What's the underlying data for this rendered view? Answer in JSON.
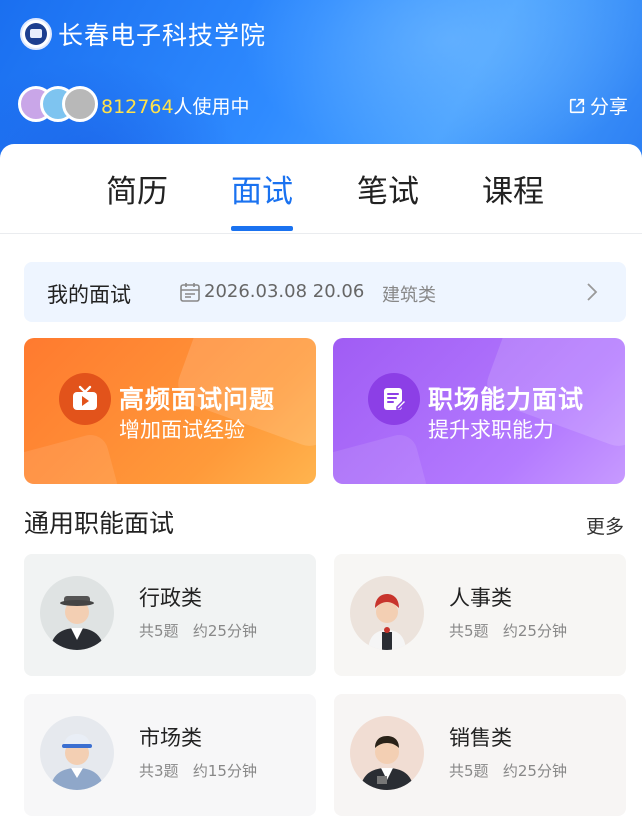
{
  "header": {
    "school_name": "长春电子科技学院",
    "user_count": "812764",
    "user_suffix": "人使用中",
    "share_label": "分享"
  },
  "tabs": [
    {
      "label": "简历",
      "active": false
    },
    {
      "label": "面试",
      "active": true
    },
    {
      "label": "笔试",
      "active": false
    },
    {
      "label": "课程",
      "active": false
    }
  ],
  "my_interview": {
    "label": "我的面试",
    "date": "2026.03.08 20.06",
    "category": "建筑类"
  },
  "feature_cards": [
    {
      "title": "高频面试问题",
      "subtitle": "增加面试经验",
      "icon": "tv-play-icon",
      "color": "#ff8a35"
    },
    {
      "title": "职场能力面试",
      "subtitle": "提升求职能力",
      "icon": "edit-document-icon",
      "color": "#a86af7"
    }
  ],
  "section": {
    "title": "通用职能面试",
    "more_label": "更多"
  },
  "job_cards": [
    {
      "title": "行政类",
      "questions": "共5题",
      "duration": "约25分钟"
    },
    {
      "title": "人事类",
      "questions": "共5题",
      "duration": "约25分钟"
    },
    {
      "title": "市场类",
      "questions": "共3题",
      "duration": "约15分钟"
    },
    {
      "title": "销售类",
      "questions": "共5题",
      "duration": "约25分钟"
    }
  ],
  "colors": {
    "accent": "#1a72f0",
    "user_count": "#ffe24a"
  }
}
